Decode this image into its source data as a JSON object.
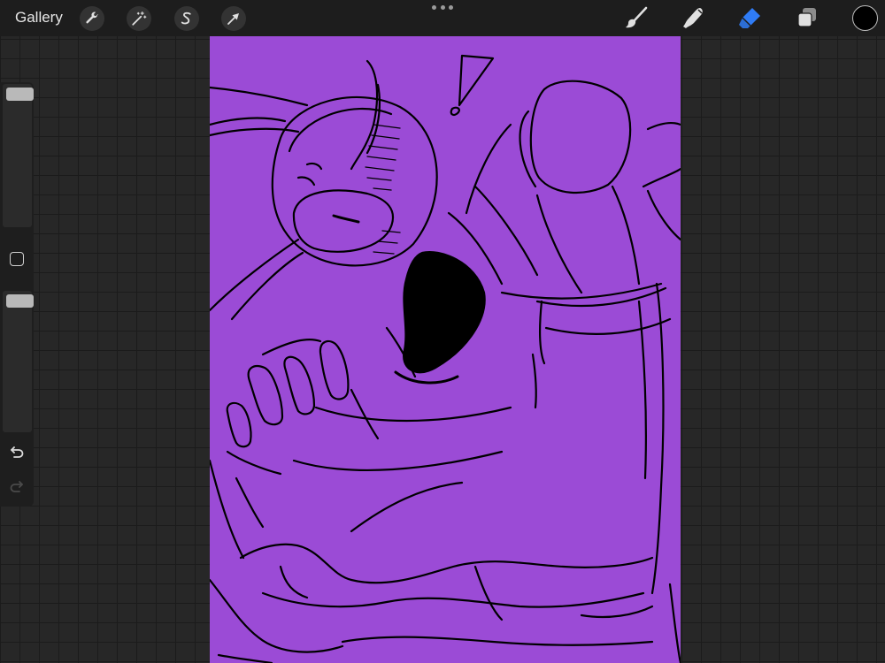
{
  "topbar": {
    "gallery_label": "Gallery",
    "left_tools": [
      {
        "name": "actions",
        "icon": "wrench-icon"
      },
      {
        "name": "adjustments",
        "icon": "magic-wand-icon"
      },
      {
        "name": "selection",
        "icon": "selection-s-icon"
      },
      {
        "name": "transform",
        "icon": "arrow-cursor-icon"
      }
    ],
    "center_menu_icon": "more-dots-icon",
    "right_tools": [
      {
        "name": "brush",
        "icon": "brush-icon",
        "active": false
      },
      {
        "name": "smudge",
        "icon": "smudge-finger-icon",
        "active": false
      },
      {
        "name": "eraser",
        "icon": "eraser-icon",
        "active": true
      },
      {
        "name": "layers",
        "icon": "layers-icon",
        "active": false
      }
    ],
    "current_color": "#000000"
  },
  "sidebar": {
    "brush_size_level": 1.0,
    "opacity_level": 1.0,
    "modifier_icon": "square-modifier-icon",
    "undo_icon": "undo-icon",
    "redo_icon": "redo-icon"
  },
  "canvas": {
    "background_color": "#9b4bd6",
    "stroke_color": "#000000"
  },
  "colors": {
    "topbar_bg": "#1d1d1d",
    "accent_active": "#2f7cf6",
    "icon_default": "#e0e0e0"
  }
}
